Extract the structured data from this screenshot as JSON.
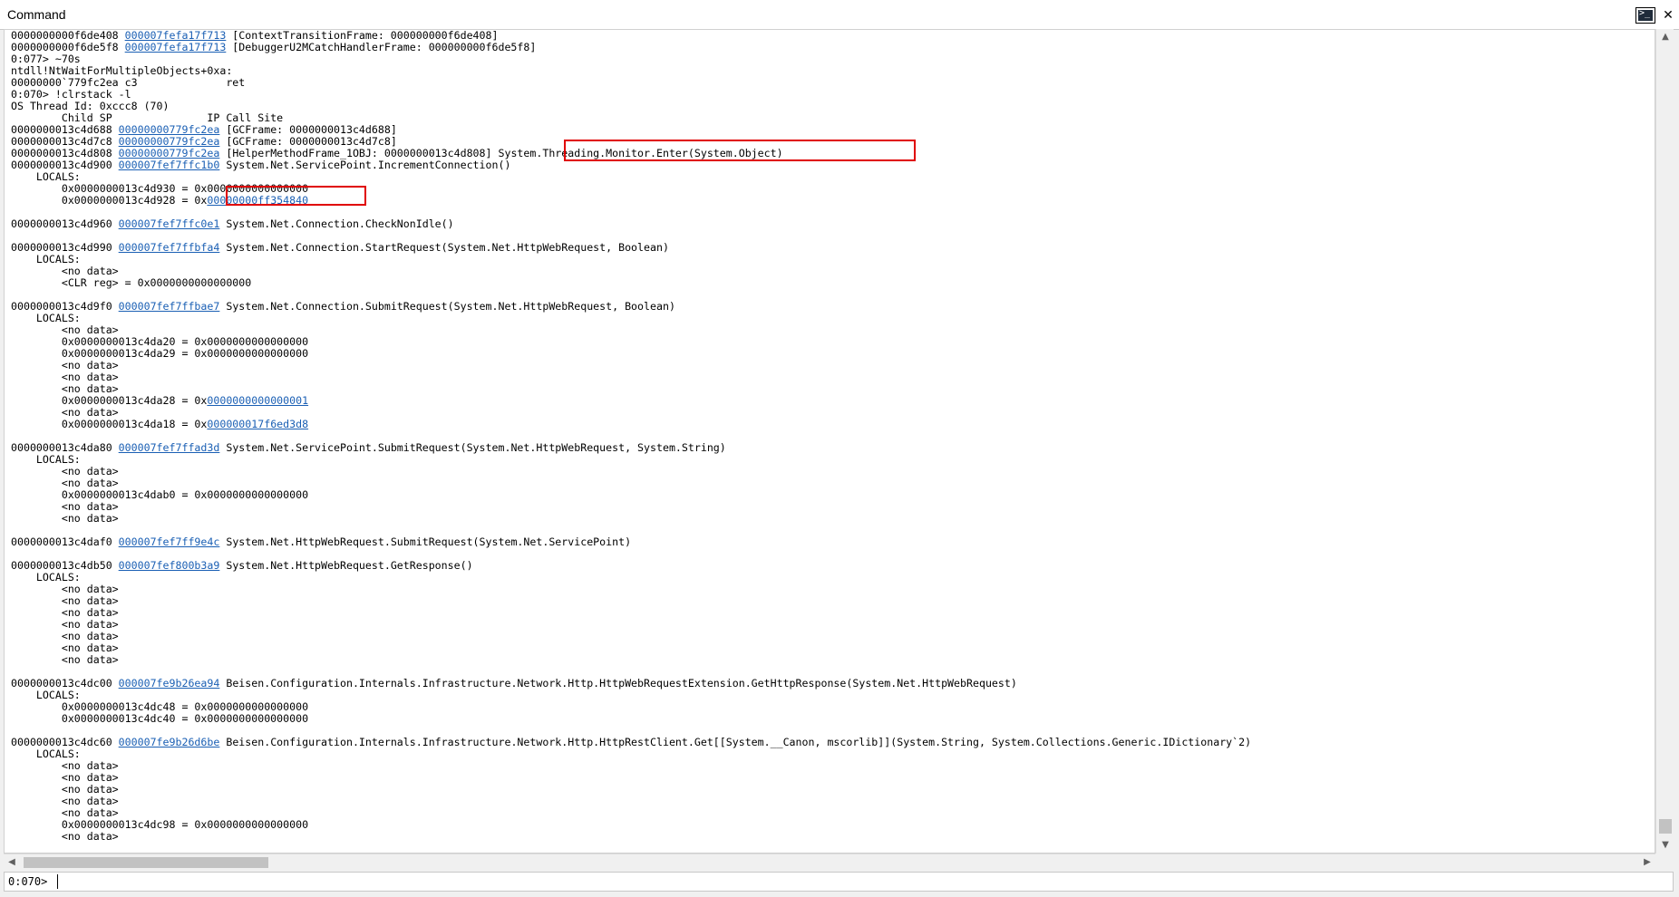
{
  "window": {
    "title": "Command"
  },
  "lines": [
    [
      {
        "t": "0000000000f6de408 "
      },
      {
        "t": "000007fefa17f713",
        "l": true
      },
      {
        "t": " [ContextTransitionFrame: 000000000f6de408]"
      }
    ],
    [
      {
        "t": "0000000000f6de5f8 "
      },
      {
        "t": "000007fefa17f713",
        "l": true
      },
      {
        "t": " [DebuggerU2MCatchHandlerFrame: 000000000f6de5f8]"
      }
    ],
    [
      {
        "t": "0:077> ~70s"
      }
    ],
    [
      {
        "t": "ntdll!NtWaitForMultipleObjects+0xa:"
      }
    ],
    [
      {
        "t": "00000000`779fc2ea c3              ret"
      }
    ],
    [
      {
        "t": "0:070> !clrstack -l"
      }
    ],
    [
      {
        "t": "OS Thread Id: 0xccc8 (70)"
      }
    ],
    [
      {
        "t": "        Child SP               IP Call Site"
      }
    ],
    [
      {
        "t": "0000000013c4d688 "
      },
      {
        "t": "00000000779fc2ea",
        "l": true
      },
      {
        "t": " [GCFrame: 0000000013c4d688]"
      }
    ],
    [
      {
        "t": "0000000013c4d7c8 "
      },
      {
        "t": "00000000779fc2ea",
        "l": true
      },
      {
        "t": " [GCFrame: 0000000013c4d7c8]"
      }
    ],
    [
      {
        "t": "0000000013c4d808 "
      },
      {
        "t": "00000000779fc2ea",
        "l": true
      },
      {
        "t": " [HelperMethodFrame_1OBJ: 0000000013c4d808] System.Threading.Monitor.Enter(System.Object)"
      }
    ],
    [
      {
        "t": "0000000013c4d900 "
      },
      {
        "t": "000007fef7ffc1b0",
        "l": true
      },
      {
        "t": " System.Net.ServicePoint.IncrementConnection()"
      }
    ],
    [
      {
        "t": "    LOCALS:"
      }
    ],
    [
      {
        "t": "        0x0000000013c4d930 = 0x0000000000000000"
      }
    ],
    [
      {
        "t": "        0x0000000013c4d928 = 0x"
      },
      {
        "t": "00000000ff354840",
        "l": true
      }
    ],
    [
      {
        "t": ""
      }
    ],
    [
      {
        "t": "0000000013c4d960 "
      },
      {
        "t": "000007fef7ffc0e1",
        "l": true
      },
      {
        "t": " System.Net.Connection.CheckNonIdle()"
      }
    ],
    [
      {
        "t": ""
      }
    ],
    [
      {
        "t": "0000000013c4d990 "
      },
      {
        "t": "000007fef7ffbfa4",
        "l": true
      },
      {
        "t": " System.Net.Connection.StartRequest(System.Net.HttpWebRequest, Boolean)"
      }
    ],
    [
      {
        "t": "    LOCALS:"
      }
    ],
    [
      {
        "t": "        <no data>"
      }
    ],
    [
      {
        "t": "        <CLR reg> = 0x0000000000000000"
      }
    ],
    [
      {
        "t": ""
      }
    ],
    [
      {
        "t": "0000000013c4d9f0 "
      },
      {
        "t": "000007fef7ffbae7",
        "l": true
      },
      {
        "t": " System.Net.Connection.SubmitRequest(System.Net.HttpWebRequest, Boolean)"
      }
    ],
    [
      {
        "t": "    LOCALS:"
      }
    ],
    [
      {
        "t": "        <no data>"
      }
    ],
    [
      {
        "t": "        0x0000000013c4da20 = 0x0000000000000000"
      }
    ],
    [
      {
        "t": "        0x0000000013c4da29 = 0x0000000000000000"
      }
    ],
    [
      {
        "t": "        <no data>"
      }
    ],
    [
      {
        "t": "        <no data>"
      }
    ],
    [
      {
        "t": "        <no data>"
      }
    ],
    [
      {
        "t": "        0x0000000013c4da28 = 0x"
      },
      {
        "t": "0000000000000001",
        "l": true
      }
    ],
    [
      {
        "t": "        <no data>"
      }
    ],
    [
      {
        "t": "        0x0000000013c4da18 = 0x"
      },
      {
        "t": "000000017f6ed3d8",
        "l": true
      }
    ],
    [
      {
        "t": ""
      }
    ],
    [
      {
        "t": "0000000013c4da80 "
      },
      {
        "t": "000007fef7ffad3d",
        "l": true
      },
      {
        "t": " System.Net.ServicePoint.SubmitRequest(System.Net.HttpWebRequest, System.String)"
      }
    ],
    [
      {
        "t": "    LOCALS:"
      }
    ],
    [
      {
        "t": "        <no data>"
      }
    ],
    [
      {
        "t": "        <no data>"
      }
    ],
    [
      {
        "t": "        0x0000000013c4dab0 = 0x0000000000000000"
      }
    ],
    [
      {
        "t": "        <no data>"
      }
    ],
    [
      {
        "t": "        <no data>"
      }
    ],
    [
      {
        "t": ""
      }
    ],
    [
      {
        "t": "0000000013c4daf0 "
      },
      {
        "t": "000007fef7ff9e4c",
        "l": true
      },
      {
        "t": " System.Net.HttpWebRequest.SubmitRequest(System.Net.ServicePoint)"
      }
    ],
    [
      {
        "t": ""
      }
    ],
    [
      {
        "t": "0000000013c4db50 "
      },
      {
        "t": "000007fef800b3a9",
        "l": true
      },
      {
        "t": " System.Net.HttpWebRequest.GetResponse()"
      }
    ],
    [
      {
        "t": "    LOCALS:"
      }
    ],
    [
      {
        "t": "        <no data>"
      }
    ],
    [
      {
        "t": "        <no data>"
      }
    ],
    [
      {
        "t": "        <no data>"
      }
    ],
    [
      {
        "t": "        <no data>"
      }
    ],
    [
      {
        "t": "        <no data>"
      }
    ],
    [
      {
        "t": "        <no data>"
      }
    ],
    [
      {
        "t": "        <no data>"
      }
    ],
    [
      {
        "t": ""
      }
    ],
    [
      {
        "t": "0000000013c4dc00 "
      },
      {
        "t": "000007fe9b26ea94",
        "l": true
      },
      {
        "t": " Beisen.Configuration.Internals.Infrastructure.Network.Http.HttpWebRequestExtension.GetHttpResponse(System.Net.HttpWebRequest)"
      }
    ],
    [
      {
        "t": "    LOCALS:"
      }
    ],
    [
      {
        "t": "        0x0000000013c4dc48 = 0x0000000000000000"
      }
    ],
    [
      {
        "t": "        0x0000000013c4dc40 = 0x0000000000000000"
      }
    ],
    [
      {
        "t": ""
      }
    ],
    [
      {
        "t": "0000000013c4dc60 "
      },
      {
        "t": "000007fe9b26d6be",
        "l": true
      },
      {
        "t": " Beisen.Configuration.Internals.Infrastructure.Network.Http.HttpRestClient.Get[[System.__Canon, mscorlib]](System.String, System.Collections.Generic.IDictionary`2)"
      }
    ],
    [
      {
        "t": "    LOCALS:"
      }
    ],
    [
      {
        "t": "        <no data>"
      }
    ],
    [
      {
        "t": "        <no data>"
      }
    ],
    [
      {
        "t": "        <no data>"
      }
    ],
    [
      {
        "t": "        <no data>"
      }
    ],
    [
      {
        "t": "        <no data>"
      }
    ],
    [
      {
        "t": "        0x0000000013c4dc98 = 0x0000000000000000"
      }
    ],
    [
      {
        "t": "        <no data>"
      }
    ]
  ],
  "prompt": {
    "label": "0:070>",
    "value": ""
  },
  "icons": {
    "titlebar_button": "console-icon",
    "close": "close-icon",
    "scroll_up": "scroll-up-icon",
    "scroll_down": "scroll-down-icon"
  },
  "colors": {
    "link": "#1a5fb4",
    "highlight_box": "#e00000"
  }
}
